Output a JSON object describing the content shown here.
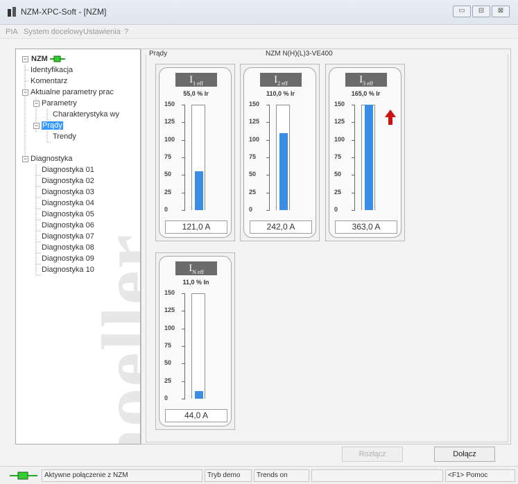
{
  "window": {
    "title": "NZM-XPC-Soft - [NZM]",
    "buttons": {
      "minimize": "▭",
      "restore": "⊟",
      "close": "⊠"
    }
  },
  "menu": [
    "PIA",
    "System docelowy",
    "Ustawienia",
    "?"
  ],
  "tree": {
    "root": "NZM",
    "items": [
      "Identyfikacja",
      "Komentarz",
      "Aktualne parametry prac",
      "Parametry",
      "Charakterystyka wy",
      "Prądy",
      "Trendy",
      "Diagnostyka",
      "Diagnostyka 01",
      "Diagnostyka 02",
      "Diagnostyka 03",
      "Diagnostyka 04",
      "Diagnostyka 05",
      "Diagnostyka 06",
      "Diagnostyka 07",
      "Diagnostyka 08",
      "Diagnostyka 09",
      "Diagnostyka 10"
    ],
    "watermark": "moeller"
  },
  "content": {
    "section_label": "Prądy",
    "device_label": "NZM N(H)(L)3-VE400",
    "scale_labels": [
      "150",
      "125",
      "100",
      "75",
      "50",
      "25",
      "0"
    ],
    "cards": [
      {
        "tag_main": "I",
        "tag_sub": "1 eff",
        "pct": "55,0 % Ir",
        "value": "121,0 A",
        "fill_pct": 55,
        "warning": false
      },
      {
        "tag_main": "I",
        "tag_sub": "2 eff",
        "pct": "110,0 % Ir",
        "value": "242,0 A",
        "fill_pct": 110,
        "warning": false
      },
      {
        "tag_main": "I",
        "tag_sub": "3 eff",
        "pct": "165,0 % Ir",
        "value": "363,0 A",
        "fill_pct": 150,
        "warning": true
      },
      {
        "tag_main": "I",
        "tag_sub": "N eff",
        "pct": "11,0 % In",
        "value": "44,0 A",
        "fill_pct": 11,
        "warning": false
      }
    ]
  },
  "buttons": {
    "disconnect": "Rozłącz",
    "connect": "Dołącz"
  },
  "status": {
    "connection": "Aktywne połączenie z NZM",
    "mode": "Tryb demo",
    "trends": "Trends on",
    "help": "<F1> Pomoc"
  },
  "colors": {
    "bar_fill": "#3a8ee6",
    "warning": "#cc1111",
    "selection": "#3399ff"
  }
}
